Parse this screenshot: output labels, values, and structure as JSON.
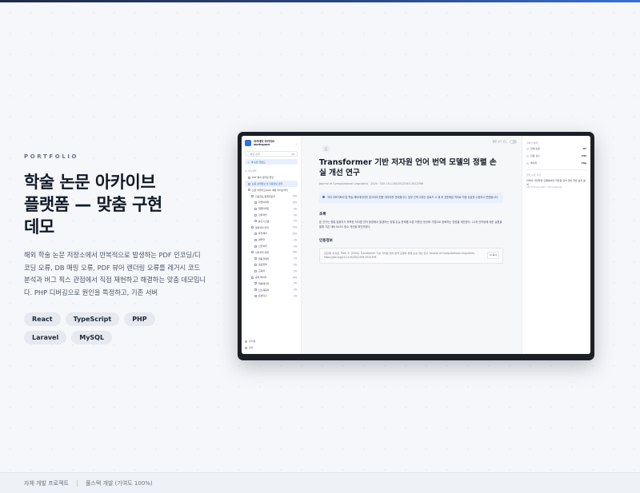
{
  "intro": {
    "eyebrow": "PORTFOLIO",
    "headline_lines": [
      "학술 논문 아카이브",
      "플랫폼 — 맞춤 구현",
      "데모"
    ],
    "description": "해외 학술 논문 저장소에서 반복적으로 발생하는 PDF 인코딩/디코딩 오류, DB 매핑 오류, PDF 뷰어 렌더링 오류를 레거시 코드 분석과 버그 픽스 관점에서 직접 재현하고 해결하는 맞춤 데모입니다. PHP 디버깅으로 원인을 특정하고, 기존 서버",
    "chips": [
      "React",
      "TypeScript",
      "PHP",
      "Laravel",
      "MySQL"
    ]
  },
  "footer": {
    "left": "자체 개발 프로젝트",
    "right": "풀스택 개발 (기여도 100%)"
  },
  "app": {
    "brand_line1": "아카데미 아카이브",
    "brand_line2": "workspace",
    "search_placeholder": "빠른 검색",
    "search_shortcut": "⌘K",
    "new_button": "새 논문 업로드",
    "section_label": "내 서재 목록",
    "tree": [
      {
        "label": "PDF 뷰어 렌더링 원인",
        "count": "",
        "indent": 1,
        "active": false
      },
      {
        "label": "논문 상세정보 및 인용정보 관리",
        "count": "",
        "indent": 1,
        "active": true
      },
      {
        "label": "오픈 아카이브(OAI) 매핑 라이브러리",
        "count": "",
        "indent": 1,
        "active": false
      },
      {
        "label": "인공지능·컴퓨터공학",
        "count": "(32)",
        "indent": 2,
        "active": false
      },
      {
        "label": "자연어처리",
        "count": "(15)",
        "indent": 3,
        "active": false
      },
      {
        "label": "컴퓨터비전",
        "count": "(9)",
        "indent": 3,
        "active": false
      },
      {
        "label": "강화학습",
        "count": "(6)",
        "indent": 3,
        "active": false
      },
      {
        "label": "분산시스템",
        "count": "(2)",
        "indent": 3,
        "active": false
      },
      {
        "label": "생명과학·의학",
        "count": "(24)",
        "indent": 2,
        "active": false
      },
      {
        "label": "유전체학",
        "count": "(11)",
        "indent": 3,
        "active": false
      },
      {
        "label": "면역학",
        "count": "(8)",
        "indent": 3,
        "active": false
      },
      {
        "label": "신경과학",
        "count": "(5)",
        "indent": 3,
        "active": false
      },
      {
        "label": "사회과학·경제",
        "count": "(18)",
        "indent": 2,
        "active": false
      },
      {
        "label": "행동경제학",
        "count": "(7)",
        "indent": 3,
        "active": false
      },
      {
        "label": "공공정책",
        "count": "(6)",
        "indent": 3,
        "active": false
      },
      {
        "label": "교육학",
        "count": "(5)",
        "indent": 3,
        "active": false
      },
      {
        "label": "공학·에너지",
        "count": "(15)",
        "indent": 2,
        "active": false
      },
      {
        "label": "재생에너지",
        "count": "(6)",
        "indent": 3,
        "active": false
      },
      {
        "label": "신소재공학",
        "count": "(5)",
        "indent": 3,
        "active": false
      },
      {
        "label": "로보틱스",
        "count": "(4)",
        "indent": 3,
        "active": false
      }
    ],
    "side_bottom": [
      "휴지통",
      "설정"
    ],
    "top_toggle_label": "원문 보기 모드",
    "doc": {
      "title": "Transformer 기반 저자원 언어 번역 모델의 정렬 손실 개선 연구",
      "meta": "Journal of Computational Linguistics · 2024 · DOI 10.1145/3512345.3512398",
      "notice": "저자 리포지토리 및 학술 메타데이터를 참고하여 원문 데이터를 관리합니다. 일부 인덱 오류는 업로드 시 배 후 표준화된 처리로 자동 유효를 수정하고 반영됩니다.",
      "abstract_heading": "초록",
      "abstract": "본 연구는 병렬 말뭉치가 부족한 저자원 언어 환경에서 발생하는 정렬 손실 문제를 다룬 어텐션 정규화 기법으로 완화하는 방법을 제안한다. 12개 언어쌍에 대한 실험을 통해 기존 대비 BLEU 점수 개선을 확인하였다.",
      "citation_heading": "인용정보",
      "citation": "김민재, 이지은, Park, S. (2024). Transformer 기반 저자원 언어 번역 모델의 정렬 손실 개선 연구. Journal of Computational Linguistics. https://doi.org/10.1145/3512345.3512398",
      "copy_label": "복사"
    },
    "right": {
      "stats_heading": "컬렉션 통계",
      "stats": [
        {
          "label": "전체 논문",
          "value": "87"
        },
        {
          "label": "인용 횟수",
          "value": "342"
        },
        {
          "label": "페이지",
          "value": "18p"
        }
      ],
      "related_heading": "관련 논문 추천",
      "related_title": "다국어 사전학습 모델에서의 저자원 언어 전이 학습 효과 분석",
      "related_sub": "ACL Findings 2023 · Kim & Nguyen"
    }
  }
}
